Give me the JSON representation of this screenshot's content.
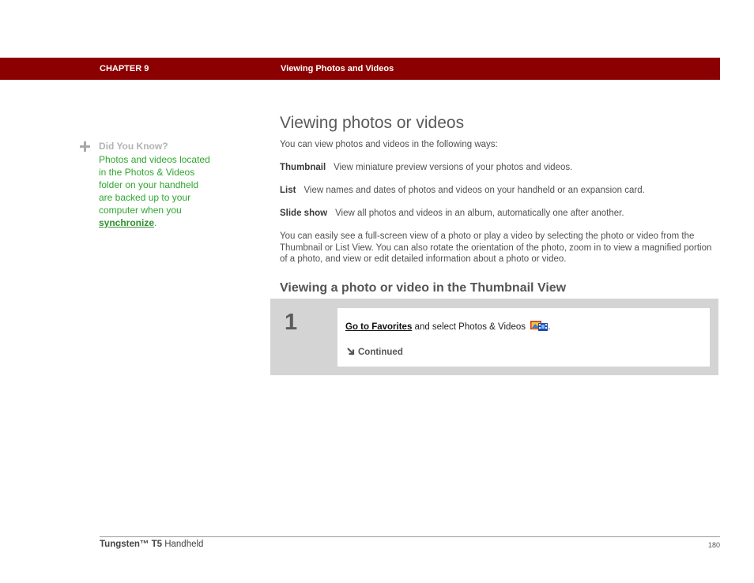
{
  "header": {
    "chapter": "CHAPTER 9",
    "title": "Viewing Photos and Videos",
    "bar_color": "#8b0000"
  },
  "sidebar": {
    "icon": "plus-icon",
    "heading": "Did You Know?",
    "body_before_link": "Photos and videos located in the Photos & Videos folder on your handheld are backed up to your computer when you ",
    "link": "synchronize",
    "body_after_link": ".",
    "text_color": "#2fa52f"
  },
  "main": {
    "title": "Viewing photos or videos",
    "intro": "You can view photos and videos in the following ways:",
    "views": [
      {
        "term": "Thumbnail",
        "description": "View miniature preview versions of your photos and videos."
      },
      {
        "term": "List",
        "description": "View names and dates of photos and videos on your handheld or an expansion card."
      },
      {
        "term": "Slide show",
        "description": "View all photos and videos in an album, automatically one after another."
      }
    ],
    "paragraph": "You can easily see a full-screen view of a photo or play a video by selecting the photo or video from the Thumbnail or List View. You can also rotate the orientation of the photo, zoom in to view a magnified portion of a photo, and view or edit detailed information about a photo or video.",
    "subheading": "Viewing a photo or video in the Thumbnail View"
  },
  "step": {
    "number": "1",
    "link": "Go to Favorites",
    "text": " and select Photos & Videos ",
    "after_icon": ".",
    "icon": "photos-videos-icon",
    "continued": "Continued",
    "continued_icon": "arrow-down-right-icon"
  },
  "footer": {
    "brand": "Tungsten™ T5",
    "product": " Handheld",
    "page": "180"
  }
}
